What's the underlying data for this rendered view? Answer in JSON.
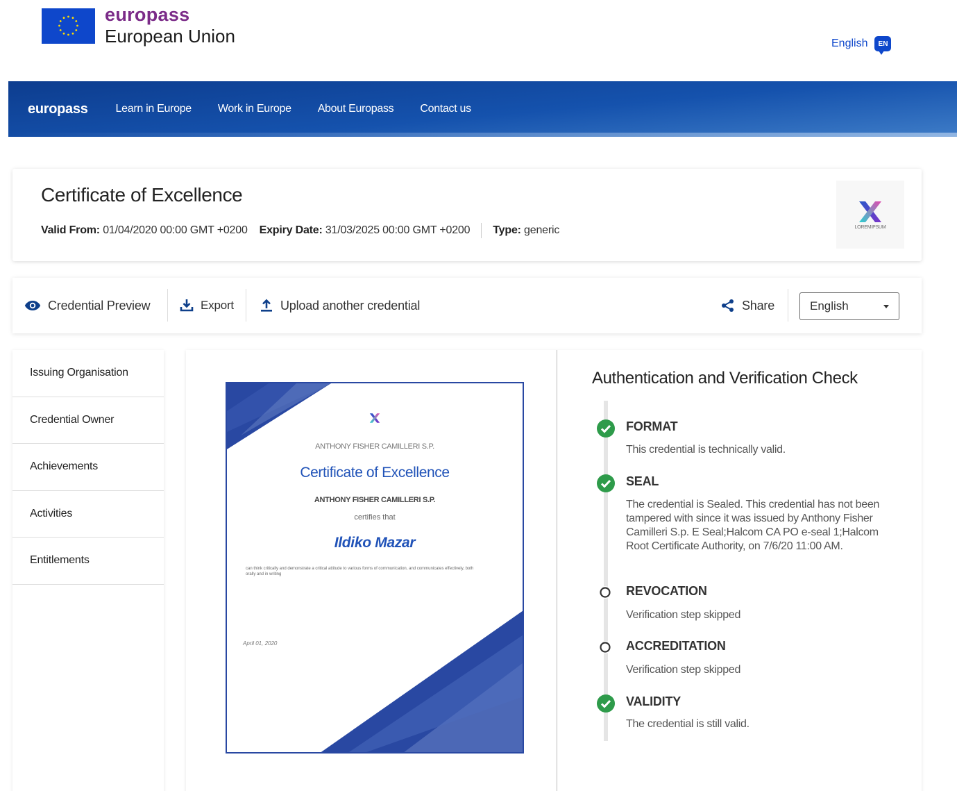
{
  "header": {
    "brand_title": "europass",
    "brand_subtitle": "European Union",
    "language": "English",
    "language_code": "EN"
  },
  "nav": {
    "brand": "europass",
    "items": [
      "Learn in Europe",
      "Work in Europe",
      "About Europass",
      "Contact us"
    ]
  },
  "credential": {
    "title": "Certificate of Excellence",
    "valid_from_label": "Valid From:",
    "valid_from": "01/04/2020 00:00 GMT +0200",
    "expiry_label": "Expiry Date:",
    "expiry": "31/03/2025 00:00 GMT +0200",
    "type_label": "Type:",
    "type": "generic",
    "logo_text": "LOREMIPSUM"
  },
  "toolbar": {
    "preview": "Credential Preview",
    "export": "Export",
    "upload": "Upload another credential",
    "share": "Share",
    "language": "English"
  },
  "side_menu": [
    "Issuing Organisation",
    "Credential Owner",
    "Achievements",
    "Activities",
    "Entitlements"
  ],
  "certificate": {
    "issuer": "ANTHONY FISHER CAMILLERI S.P.",
    "title": "Certificate of Excellence",
    "certifies": "certifies that",
    "recipient": "Ildiko Mazar",
    "description": "can think critically and demonstrate a critical attitude to various forms of communication, and communicates effectively, both orally and in writing",
    "date": "April 01, 2020"
  },
  "verification": {
    "title": "Authentication and Verification Check",
    "steps": [
      {
        "name": "FORMAT",
        "status": "passed",
        "description": "This credential is technically valid."
      },
      {
        "name": "SEAL",
        "status": "passed",
        "description": "The credential is Sealed. This credential has not been tampered with since it was issued by Anthony Fisher Camilleri S.p. E Seal;Halcom CA PO e-seal 1;Halcom Root Certificate Authority, on 7/6/20 11:00 AM."
      },
      {
        "name": "REVOCATION",
        "status": "skipped",
        "description": "Verification step skipped"
      },
      {
        "name": "ACCREDITATION",
        "status": "skipped",
        "description": "Verification step skipped"
      },
      {
        "name": "VALIDITY",
        "status": "passed",
        "description": "The credential is still valid."
      }
    ]
  },
  "colors": {
    "brand_purple": "#7b2b88",
    "eu_blue": "#0e47cb",
    "nav_blue": "#1552ad",
    "success_green": "#2e9b4a",
    "cert_blue": "#2948a2"
  }
}
